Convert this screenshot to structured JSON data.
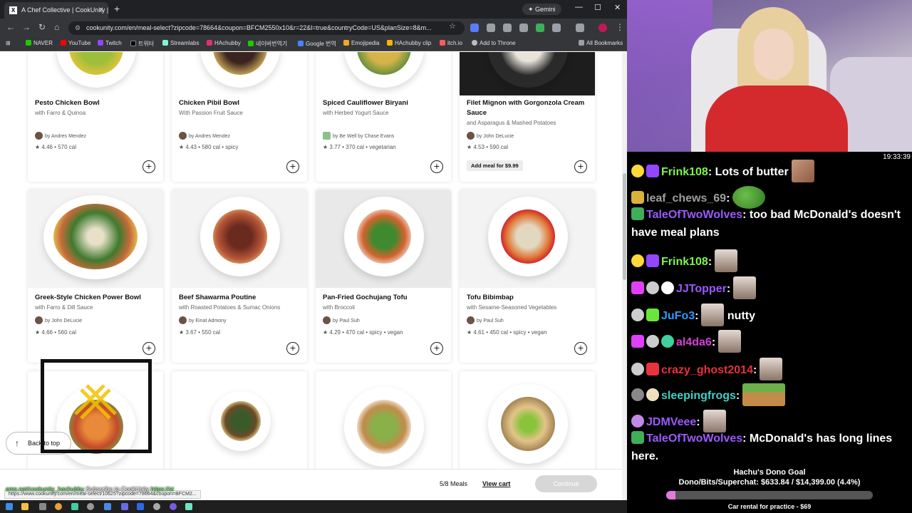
{
  "browser": {
    "tab_title": "A Chef Collective | CookUnity | ",
    "tab_close": "✕",
    "new_tab": "+",
    "gemini_label": "✦ Gemini",
    "url": "cookunity.com/en/meal-select?zipcode=78664&coupon=BFCM2550x10&r=22&l=true&countryCode=US&planSize=8&m...",
    "bookmarks": [
      "NAVER",
      "YouTube",
      "Twitch",
      "트위터",
      "Streamlabs",
      "HAchubby",
      "네이버번역기",
      "Google 번역",
      "Emojipedia",
      "HAchubby clip",
      "itch.io",
      "Add to Throne"
    ],
    "all_bookmarks": "All Bookmarks"
  },
  "meals": [
    {
      "name": "Pesto Chicken Bowl",
      "sub": "with Farro & Quinoa",
      "chef": "by Andres Mendez",
      "meta": "4.46 • 570 cal"
    },
    {
      "name": "Chicken Pibil Bowl",
      "sub": "With Passion Fruit Sauce",
      "chef": "by Andres Mendez",
      "meta": "4.43 • 580 cal • spicy"
    },
    {
      "name": "Spiced Cauliflower Biryani",
      "sub": "with Herbed Yogurt Sauce",
      "chef": "by Be Well by Chase Evans",
      "meta": "3.77 • 370 cal • vegetarian"
    },
    {
      "name": "Filet Mignon with Gorgonzola Cream Sauce",
      "sub": "and Asparagus & Mashed Potatoes",
      "chef": "by John DeLucie",
      "meta": "4.53 • 590 cal",
      "promo": "Add meal for $9.99"
    },
    {
      "name": "Greek-Style Chicken Power Bowl",
      "sub": "with Farro & Dill Sauce",
      "chef": "by John DeLucie",
      "meta": "4.66 • 560 cal"
    },
    {
      "name": "Beef Shawarma Poutine",
      "sub": "with Roasted Potatoes & Sumac Onions",
      "chef": "by Einat Admony",
      "meta": "3.67 • 550 cal"
    },
    {
      "name": "Pan-Fried Gochujang Tofu",
      "sub": "with Broccoli",
      "chef": "by Paul Suh",
      "meta": "4.29 • 470 cal • spicy • vegan"
    },
    {
      "name": "Tofu Bibimbap",
      "sub": "with Sesame-Seasoned Vegetables",
      "chef": "by Paul Suh",
      "meta": "4.61 • 450 cal • spicy • vegan"
    }
  ],
  "page": {
    "back_to_top": "Back to top",
    "meals_count": "5/8 Meals",
    "view_cart": "View cart",
    "continue": "Continue",
    "status_url": "https://www.cookunity.com/en/meal-select/10625?zipcode=78664&coupon=BFCM2...",
    "hover_green": "ems.net/cookunity_hachubby",
    "hover_white": " Subscribe to CookUnity ",
    "hover_green2": "https://st"
  },
  "chat": {
    "clock": "19:33:39",
    "messages": [
      {
        "user": "Frink108",
        "color": "#7cf64a",
        "text": "Lots of butter"
      },
      {
        "user": "leaf_chews_69",
        "color": "#9e9e9e",
        "text": ""
      },
      {
        "user": "TaleOfTwoWolves",
        "color": "#9b59ff",
        "text": "too bad McDonald's doesn't have meal plans"
      },
      {
        "user": "Frink108",
        "color": "#7cf64a",
        "text": ""
      },
      {
        "user": "JJTopper",
        "color": "#9b59ff",
        "text": ""
      },
      {
        "user": "JuFo3",
        "color": "#2e9bff",
        "text": "nutty"
      },
      {
        "user": "al4da6",
        "color": "#d63fd6",
        "text": ""
      },
      {
        "user": "crazy_ghost2014",
        "color": "#e8323c",
        "text": ""
      },
      {
        "user": "sleepingfrogs",
        "color": "#3fd0c8",
        "text": ""
      },
      {
        "user": "JDMVeee",
        "color": "#9b59ff",
        "text": ""
      },
      {
        "user": "TaleOfTwoWolves",
        "color": "#9b59ff",
        "text": "McDonald's has long lines here."
      }
    ]
  },
  "dono_goal": {
    "title": "Hachu's Dono Goal",
    "line": "Dono/Bits/Superchat: $633.84 / $14,399.00 (4.4%)",
    "progress": 0.044,
    "reward": "Car rental for practice - $69"
  }
}
